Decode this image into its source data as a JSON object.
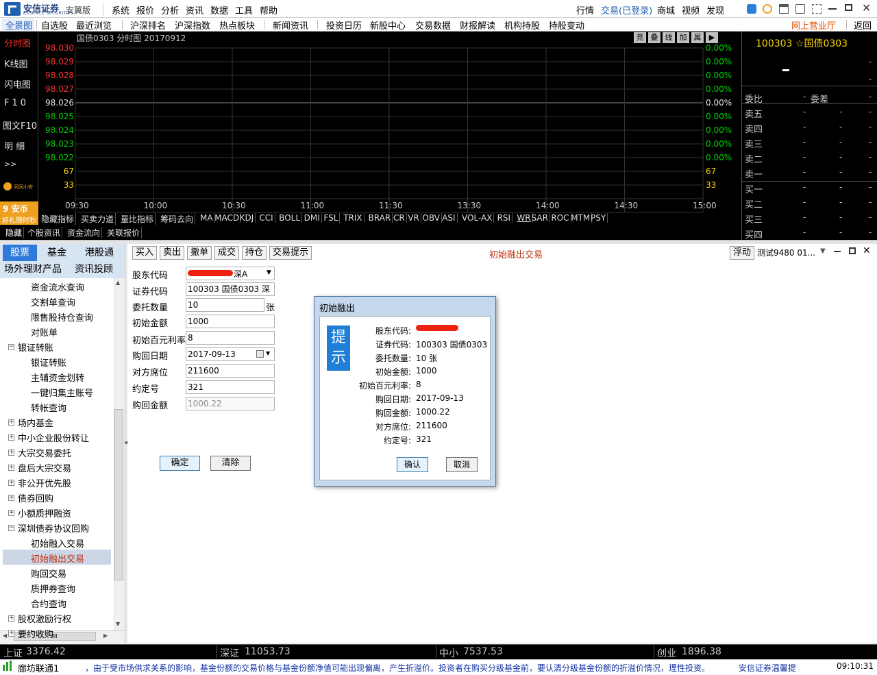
{
  "app": {
    "brand": "安信证券",
    "brand_en": "ESSENCE SECURITIES",
    "edition": "安翼版",
    "menu": [
      "系统",
      "报价",
      "分析",
      "资讯",
      "数据",
      "工具",
      "帮助"
    ],
    "right_menu": {
      "quotes": "行情",
      "trade": "交易(已登录)",
      "mall": "商城",
      "video": "视频",
      "discover": "发现"
    }
  },
  "nav": {
    "items": [
      "全景图",
      "自选股",
      "最近浏览",
      "沪深排名",
      "沪深指数",
      "热点板块",
      "新闻资讯",
      "投资日历",
      "新股中心",
      "交易数据",
      "财报解读",
      "机构持股",
      "持股变动"
    ],
    "online_hall": "网上营业厅",
    "back": "返回"
  },
  "left_nav": {
    "items": [
      "分时图",
      "K线图",
      "闪电图",
      "F10",
      "图文F10",
      "明 细",
      ">>"
    ],
    "assistant": "同同小安",
    "promo_title": "9 安币",
    "promo_sub": "好礼限时秒"
  },
  "chart": {
    "title": "国债0303 分时图 20170912",
    "toolbar": [
      "竞",
      "叠",
      "线",
      "加",
      "属",
      "▶"
    ],
    "y_labels": [
      "98.030",
      "98.029",
      "98.028",
      "98.027",
      "98.026",
      "98.025",
      "98.024",
      "98.023",
      "98.022",
      "67",
      "33"
    ],
    "pct_labels": [
      "0.00%",
      "0.00%",
      "0.00%",
      "0.00%",
      "0.00%",
      "0.00%",
      "0.00%",
      "0.00%",
      "0.00%",
      "67",
      "33"
    ],
    "x_labels": [
      "09:30",
      "10:00",
      "10:30",
      "11:00",
      "11:30",
      "13:30",
      "14:00",
      "14:30",
      "15:00"
    ],
    "indicators": [
      "隐藏指标",
      "买卖力道",
      "量比指标",
      "筹码去向",
      "MA",
      "MACD",
      "KDJ",
      "CCI",
      "BOLL",
      "DMI",
      "FSL",
      "TRIX",
      "BRAR",
      "CR",
      "VR",
      "OBV",
      "ASI",
      "VOL-AX",
      "RSI",
      "WR",
      "SAR",
      "ROC",
      "MTM",
      "PSY"
    ],
    "bottom_tabs": [
      "隐藏",
      "个股资讯",
      "资金流向",
      "关联报价"
    ]
  },
  "quote": {
    "code_name": "100303 ☆国债0303",
    "dash": "-",
    "header": [
      "委比",
      "-",
      "委差"
    ],
    "rows": [
      "卖五",
      "卖四",
      "卖三",
      "卖二",
      "卖一",
      "买一",
      "买二",
      "买三",
      "买四"
    ]
  },
  "left_panel": {
    "tabs": [
      "股票",
      "基金",
      "港股通",
      "场外理财产品",
      "资讯投顾"
    ],
    "tree": [
      {
        "label": "资金流水查询",
        "level": 2
      },
      {
        "label": "交割单查询",
        "level": 2
      },
      {
        "label": "限售股持仓查询",
        "level": 2
      },
      {
        "label": "对账单",
        "level": 2
      },
      {
        "label": "银证转账",
        "level": 1,
        "state": "⊟"
      },
      {
        "label": "银证转账",
        "level": 2
      },
      {
        "label": "主辅资金划转",
        "level": 2
      },
      {
        "label": "一键归集主账号",
        "level": 2
      },
      {
        "label": "转帐查询",
        "level": 2
      },
      {
        "label": "场内基金",
        "level": 1,
        "state": "⊞"
      },
      {
        "label": "中小企业股份转让",
        "level": 1,
        "state": "⊞"
      },
      {
        "label": "大宗交易委托",
        "level": 1,
        "state": "⊞"
      },
      {
        "label": "盘后大宗交易",
        "level": 1,
        "state": "⊞"
      },
      {
        "label": "非公开优先股",
        "level": 1,
        "state": "⊞"
      },
      {
        "label": "债券回购",
        "level": 1,
        "state": "⊞"
      },
      {
        "label": "小额质押融资",
        "level": 1,
        "state": "⊞"
      },
      {
        "label": "深圳债券协议回购",
        "level": 1,
        "state": "⊟"
      },
      {
        "label": "初始融入交易",
        "level": 2
      },
      {
        "label": "初始融出交易",
        "level": 2
      },
      {
        "label": "购回交易",
        "level": 2
      },
      {
        "label": "质押券查询",
        "level": 2
      },
      {
        "label": "合约查询",
        "level": 2
      },
      {
        "label": "股权激励行权",
        "level": 1,
        "state": "⊞"
      },
      {
        "label": "要约收购",
        "level": 1,
        "state": "⊞"
      }
    ],
    "scroll_mid": "III"
  },
  "trade_toolbar": {
    "buttons": [
      "买入",
      "卖出",
      "撤单",
      "成交",
      "持仓",
      "交易提示"
    ],
    "title": "初始融出交易",
    "float": "浮动",
    "account": "测试9480 01..."
  },
  "form": {
    "labels": [
      "股东代码",
      "证券代码",
      "委托数量",
      "初始金额",
      "初始百元利率",
      "购回日期",
      "对方席位",
      "约定号",
      "购回金额"
    ],
    "holder_suffix": "深A",
    "security": "100303 国债0303 深",
    "qty": "10",
    "qty_unit": "张",
    "amount": "1000",
    "rate": "8",
    "repo_date": "2017-09-13",
    "seat": "211600",
    "contract": "321",
    "repo_amount": "1000.22",
    "confirm": "确定",
    "clear": "清除"
  },
  "dialog": {
    "title": "初始融出",
    "tip": "提示",
    "rows": [
      {
        "label": "股东代码:",
        "value": ""
      },
      {
        "label": "证券代码:",
        "value": "100303   国债0303"
      },
      {
        "label": "委托数量:",
        "value": "10 张"
      },
      {
        "label": "初始金额:",
        "value": "1000"
      },
      {
        "label": "初始百元利率:",
        "value": "8"
      },
      {
        "label": "购回日期:",
        "value": "2017-09-13"
      },
      {
        "label": "购回金额:",
        "value": "1000.22"
      },
      {
        "label": "对方席位:",
        "value": "211600"
      },
      {
        "label": "约定号:",
        "value": "321"
      }
    ],
    "ok": "确认",
    "cancel": "取消"
  },
  "status": {
    "sh_label": "上证",
    "sh": "3376.42",
    "sz_label": "深证",
    "sz": "11053.73",
    "zx_label": "中小",
    "zx": "7537.53",
    "cy_label": "创业",
    "cy": "1896.38"
  },
  "bottom": {
    "branch": "廊坊联通1",
    "ticker": "，由于受市场供求关系的影响，基金份额的交易价格与基金份额净值可能出现偏离，产生折溢价。投资者在购买分级基金前，要认清分级基金份额的折溢价情况，理性投资。",
    "tip": "安信证券温馨提",
    "time": "09:10:31"
  },
  "colors": {
    "up": "#ff3030",
    "down": "#00d000",
    "accent": "#1f5fb0",
    "title_red": "#c03010"
  }
}
